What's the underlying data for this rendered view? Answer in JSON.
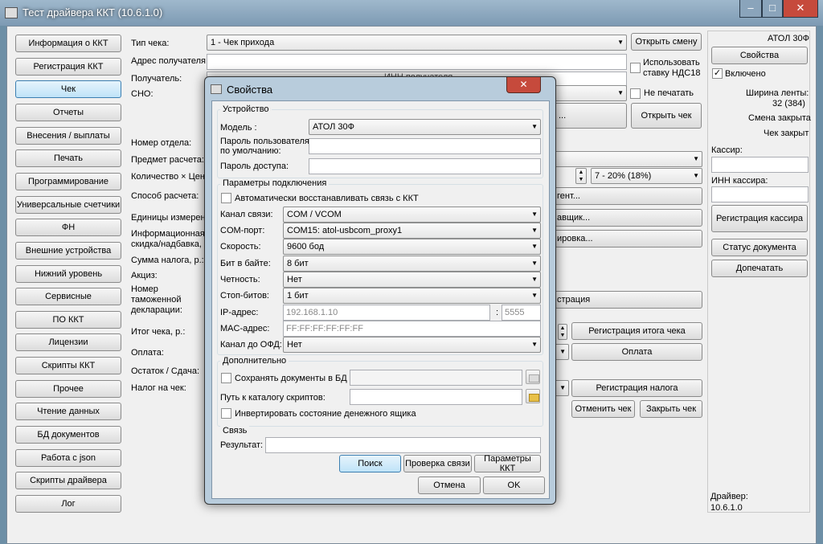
{
  "window": {
    "title": "Тест драйвера ККТ (10.6.1.0)",
    "min": "–",
    "max": "□",
    "close": "✕"
  },
  "nav": [
    "Информация о ККТ",
    "Регистрация ККТ",
    "Чек",
    "Отчеты",
    "Внесения / выплаты",
    "Печать",
    "Программирование",
    "Универсальные счетчики",
    "ФН",
    "Внешние устройства",
    "Нижний уровень",
    "Сервисные",
    "ПО ККТ",
    "Лицензии",
    "Скрипты ККТ",
    "Прочее",
    "Чтение данных",
    "БД документов",
    "Работа с json",
    "Скрипты драйвера",
    "Лог"
  ],
  "form": {
    "check_type_label": "Тип чека:",
    "check_type": "1 - Чек прихода",
    "open_shift": "Открыть смену",
    "recipient_addr": "Адрес получателя:",
    "use_vat": "Использовать ставку НДС18",
    "recipient": "Получатель:",
    "inn_recipient": "ИНН получателя",
    "sno": "СНО:",
    "no_print": "Не печатать",
    "btn_dots": "...",
    "open_check": "Открыть чек",
    "dept": "Номер отдела:",
    "subject": "Предмет расчета:",
    "qty_price": "Количество × Цена",
    "vat": "7 - 20% (18%)",
    "pay_method": "Способ расчета:",
    "agent": "гент...",
    "units": "Единицы измерения",
    "supplier": "авщик...",
    "info_discount": "Информационная скидка/надбавка,",
    "markup": "ировка...",
    "tax_sum": "Сумма налога, р.:",
    "excise": "Акциз:",
    "customs": "Номер таможенной декларации:",
    "registration": "страция",
    "total": "Итог чека, р.:",
    "reg_total": "Регистрация итога чека",
    "payment_label": "Оплата:",
    "payment_btn": "Оплата",
    "change": "Остаток / Сдача:",
    "tax_on_check": "Налог на чек:",
    "reg_tax": "Регистрация налога",
    "cancel_check": "Отменить чек",
    "close_check": "Закрыть чек"
  },
  "right": {
    "model": "АТОЛ 30Ф",
    "properties": "Свойства",
    "enabled": "Включено",
    "enabled_check": "✓",
    "tape_width_label": "Ширина ленты:",
    "tape_width": "32 (384)",
    "shift": "Смена закрыта",
    "check": "Чек закрыт",
    "cashier": "Кассир:",
    "cashier_inn": "ИНН кассира:",
    "reg_cashier": "Регистрация кассира",
    "doc_status": "Статус документа",
    "reprint": "Допечатать",
    "driver_label": "Драйвер:",
    "driver_ver": "10.6.1.0"
  },
  "dialog": {
    "title": "Свойства",
    "close": "✕",
    "device_group": "Устройство",
    "model_label": "Модель :",
    "model": "АТОЛ 30Ф",
    "user_pwd": "Пароль пользователя по умолчанию:",
    "access_pwd": "Пароль доступа:",
    "conn_group": "Параметры подключения",
    "auto_reconnect": "Автоматически восстанавливать связь с ККТ",
    "channel_label": "Канал связи:",
    "channel": "COM / VCOM",
    "port_label": "COM-порт:",
    "port": "COM15: atol-usbcom_proxy1",
    "speed_label": "Скорость:",
    "speed": "9600 бод",
    "bits_label": "Бит в байте:",
    "bits": "8 бит",
    "parity_label": "Четность:",
    "parity": "Нет",
    "stop_label": "Стоп-битов:",
    "stop": "1 бит",
    "ip_label": "IP-адрес:",
    "ip": "192.168.1.10",
    "port_colon": ":",
    "ip_port": "5555",
    "mac_label": "MAC-адрес:",
    "mac": "FF:FF:FF:FF:FF:FF",
    "ofd_label": "Канал до ОФД:",
    "ofd": "Нет",
    "extra_group": "Дополнительно",
    "save_docs": "Сохранять документы в БД",
    "scripts_path": "Путь к каталогу скриптов:",
    "invert_drawer": "Инвертировать состояние денежного ящика",
    "link_group": "Связь",
    "result_label": "Результат:",
    "search": "Поиск",
    "check_link": "Проверка связи",
    "kkt_params": "Параметры ККТ",
    "cancel": "Отмена",
    "ok": "OK"
  }
}
